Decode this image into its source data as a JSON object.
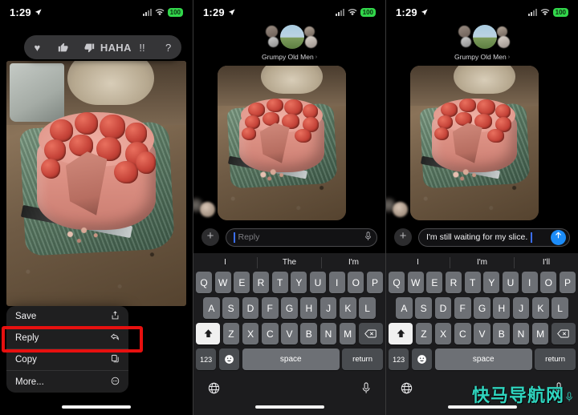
{
  "status_bar": {
    "time": "1:29",
    "location_icon": "location-arrow-icon",
    "signal_icon": "cellular-bars-icon",
    "wifi_icon": "wifi-icon",
    "battery_level": "100"
  },
  "panel1": {
    "tapbacks": [
      {
        "name": "heart-tapback",
        "glyph": "♥"
      },
      {
        "name": "thumbs-up-tapback",
        "glyph": "👍"
      },
      {
        "name": "thumbs-down-tapback",
        "glyph": "👎"
      },
      {
        "name": "haha-tapback",
        "line1": "HA",
        "line2": "HA"
      },
      {
        "name": "exclamation-tapback",
        "glyph": "!!"
      },
      {
        "name": "question-tapback",
        "glyph": "?"
      }
    ],
    "photo_alt": "strawberry-cake-photo",
    "context_menu": [
      {
        "label": "Save",
        "icon": "save-icon",
        "glyph": "↥",
        "highlighted": false
      },
      {
        "label": "Reply",
        "icon": "reply-arrow-icon",
        "glyph": "↶",
        "highlighted": true
      },
      {
        "label": "Copy",
        "icon": "copy-icon",
        "glyph": "⧉",
        "highlighted": false
      },
      {
        "label": "More...",
        "icon": "more-circle-icon",
        "glyph": "⊙",
        "highlighted": false
      }
    ],
    "highlight_color": "#e7100f"
  },
  "panel2": {
    "conversation_title": "Grumpy Old Men",
    "chevron": "›",
    "photo_alt": "strawberry-cake-photo",
    "input": {
      "placeholder": "Reply",
      "value": "",
      "plus_label": "+",
      "mic_icon": "microphone-icon"
    },
    "predictive": [
      "I",
      "The",
      "I'm"
    ]
  },
  "panel3": {
    "conversation_title": "Grumpy Old Men",
    "chevron": "›",
    "photo_alt": "strawberry-cake-photo",
    "input": {
      "placeholder": "Reply",
      "value": "I'm still waiting for my slice.",
      "plus_label": "+",
      "send_icon": "send-arrow-up-icon",
      "send_color": "#1c8cf8"
    },
    "predictive": [
      "I",
      "I'm",
      "I'll"
    ]
  },
  "keyboard": {
    "row1": [
      "Q",
      "W",
      "E",
      "R",
      "T",
      "Y",
      "U",
      "I",
      "O",
      "P"
    ],
    "row2": [
      "A",
      "S",
      "D",
      "F",
      "G",
      "H",
      "J",
      "K",
      "L"
    ],
    "row3": [
      "Z",
      "X",
      "C",
      "V",
      "B",
      "N",
      "M"
    ],
    "shift_icon": "shift-up-icon",
    "backspace_icon": "backspace-icon",
    "numbers_label": "123",
    "emoji_icon": "emoji-smiley-icon",
    "space_label": "space",
    "return_label": "return",
    "globe_icon": "globe-icon",
    "dictation_icon": "microphone-icon"
  },
  "watermark": {
    "text": "快马导航网",
    "color": "#2fd5bf"
  }
}
